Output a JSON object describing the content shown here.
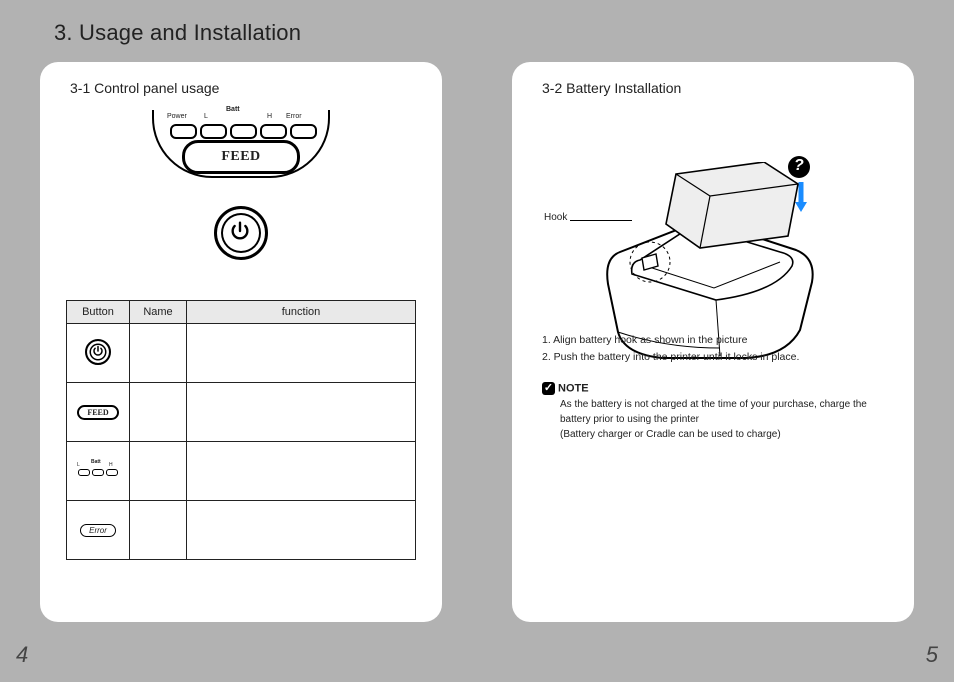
{
  "section_title": "3. Usage and Installation",
  "left": {
    "subtitle": "3-1 Control panel usage",
    "page_number": "4",
    "panel": {
      "feed_label": "FEED",
      "led_labels": {
        "power": "Power",
        "l": "L",
        "batt": "Batt",
        "h": "H",
        "error": "Error"
      }
    },
    "table": {
      "headers": {
        "button": "Button",
        "name": "Name",
        "func": "function"
      },
      "rows": [
        {
          "icon": "power",
          "name": "",
          "func": ""
        },
        {
          "icon": "feed",
          "name": "",
          "func": ""
        },
        {
          "icon": "leds",
          "name": "",
          "func": ""
        },
        {
          "icon": "error",
          "name": "",
          "func": ""
        }
      ],
      "mini": {
        "feed": "FEED",
        "error": "Error",
        "l": "L",
        "h": "H",
        "batt": "Batt"
      }
    }
  },
  "right": {
    "subtitle": "3-2 Battery Installation",
    "page_number": "5",
    "hook_label": "Hook",
    "steps": [
      "1. Align battery hook as shown in the picture",
      "2. Push the battery into the printer until it locks in place."
    ],
    "note": {
      "heading": "NOTE",
      "body_l1": "As the battery is not charged at the time of your purchase, charge the battery prior to using the printer",
      "body_l2": "(Battery charger or Cradle can be used to charge)"
    }
  }
}
